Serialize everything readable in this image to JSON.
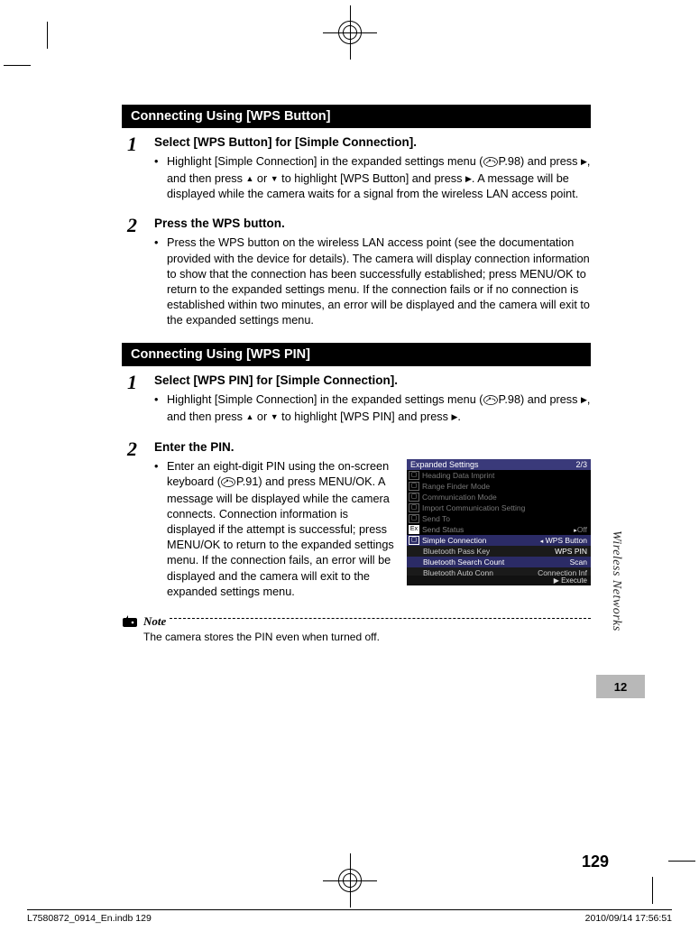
{
  "section1": {
    "title": "Connecting Using [WPS Button]",
    "steps": [
      {
        "num": "1",
        "title": "Select [WPS Button] for [Simple Connection].",
        "bullet_pre": "Highlight [Simple Connection] in the expanded settings menu (",
        "ref": "P.98",
        "bullet_mid1": ") and press ",
        "bullet_mid2": ", and then press ",
        "bullet_mid3": " or ",
        "bullet_mid4": " to highlight [WPS Button] and press ",
        "bullet_post": ". A message will be displayed while the camera waits for a signal from the wireless LAN access point."
      },
      {
        "num": "2",
        "title": "Press the WPS button.",
        "bullet": "Press the WPS button on the wireless LAN access point (see the documentation provided with the device for details). The camera will display connection information to show that the connection has been successfully established; press MENU/OK to return to the expanded settings menu. If the connection fails or if no connection is established within two minutes, an error will be displayed and the camera will exit to the expanded settings menu."
      }
    ]
  },
  "section2": {
    "title": "Connecting Using [WPS PIN]",
    "steps": [
      {
        "num": "1",
        "title": "Select [WPS PIN] for [Simple Connection].",
        "bullet_pre": "Highlight [Simple Connection] in the expanded settings menu (",
        "ref": "P.98",
        "bullet_mid1": ") and press ",
        "bullet_mid2": ", and then press ",
        "bullet_mid3": " or ",
        "bullet_mid4": " to highlight [WPS PIN] and press ",
        "bullet_post": "."
      },
      {
        "num": "2",
        "title": "Enter the PIN.",
        "bullet_pre": "Enter an eight-digit PIN using the on-screen keyboard (",
        "ref": "P.91",
        "bullet_post": ") and press MENU/OK. A message will be displayed while the camera connects. Connection information is displayed if the attempt is successful; press MENU/OK to return to the expanded settings menu. If the connection fails, an error will be displayed and the camera will exit to the expanded settings menu."
      }
    ]
  },
  "lcd": {
    "header_left": "Expanded Settings",
    "header_right": "2/3",
    "rows": [
      "Heading Data Imprint",
      "Range Finder Mode",
      "Communication Mode",
      "Import Communication Setting",
      "Send To"
    ],
    "ex_label": "Ex",
    "send_status": "Send Status",
    "send_status_val": "Off",
    "sel_row": "Simple Connection",
    "sel_val": "WPS Button",
    "sub1": "Bluetooth Pass Key",
    "sub1v": "WPS PIN",
    "sub2": "Bluetooth Search Count",
    "sub2v": "Scan",
    "sub3": "Bluetooth Auto Conn",
    "sub3v": "Connection Inf",
    "footer_left": "",
    "footer_right": "▶ Execute"
  },
  "note": {
    "label": "Note",
    "text": "The camera stores the PIN even when turned off."
  },
  "side": {
    "vtext": "Wireless Networks",
    "chapter": "12"
  },
  "page_number": "129",
  "footer": {
    "left": "L7580872_0914_En.indb   129",
    "right": "2010/09/14   17:56:51"
  }
}
